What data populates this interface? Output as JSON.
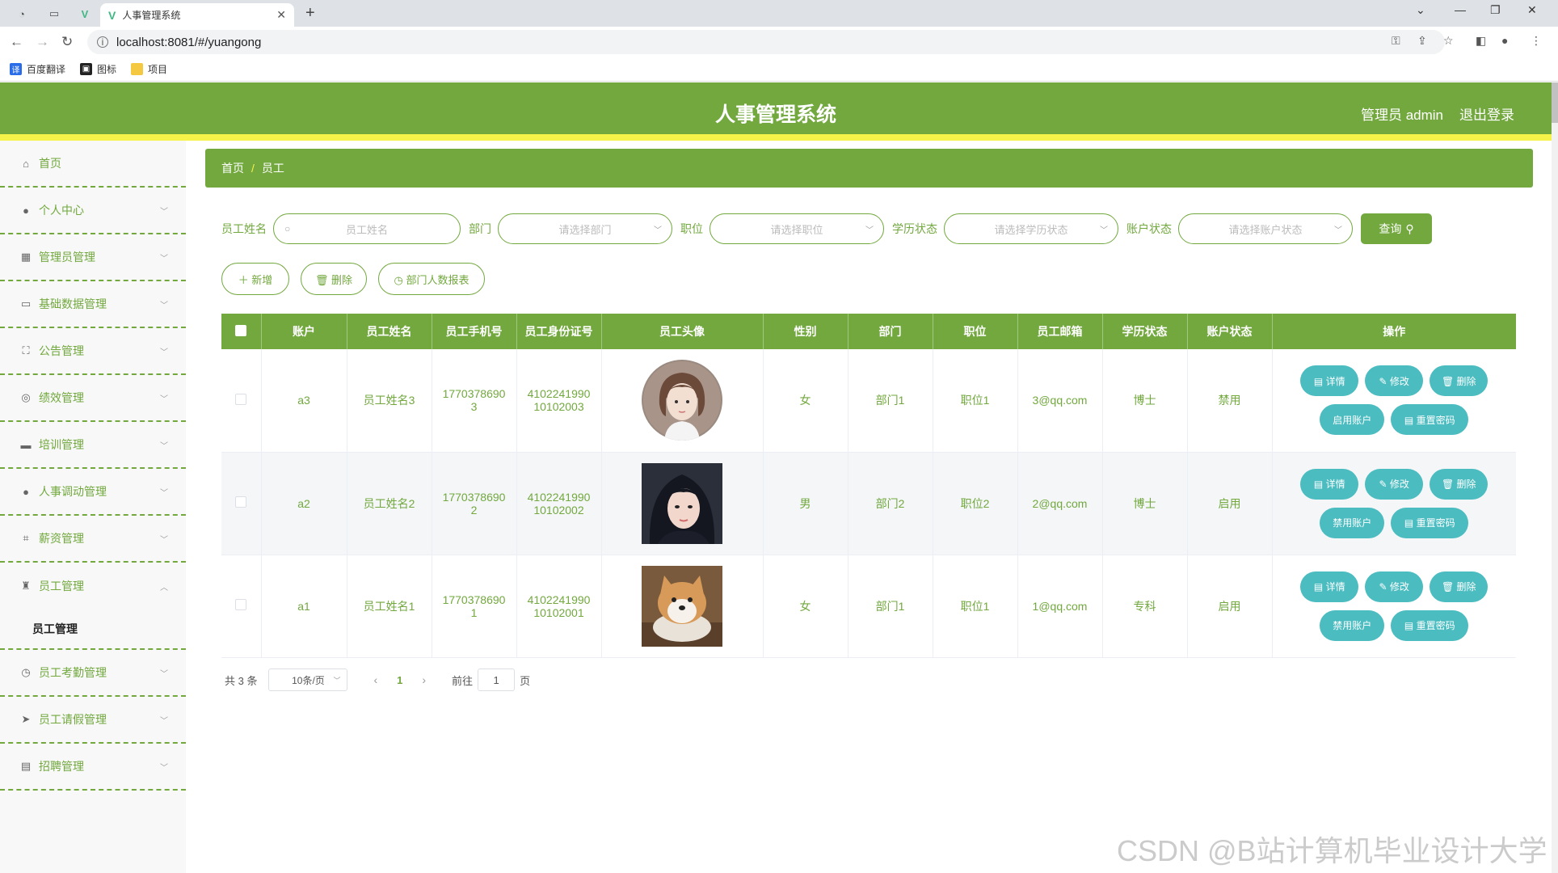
{
  "browser": {
    "tab_title": "人事管理系统",
    "url": "localhost:8081/#/yuangong",
    "bookmarks": [
      "百度翻译",
      "图标",
      "项目"
    ]
  },
  "header": {
    "title": "人事管理系统",
    "user": "管理员 admin",
    "logout": "退出登录",
    "accent": "#72a83e",
    "stripe": "#f5f24a"
  },
  "sidebar": {
    "items": [
      {
        "label": "首页",
        "icon": "home-icon"
      },
      {
        "label": "个人中心",
        "icon": "user-icon"
      },
      {
        "label": "管理员管理",
        "icon": "admin-icon"
      },
      {
        "label": "基础数据管理",
        "icon": "card-icon"
      },
      {
        "label": "公告管理",
        "icon": "frame-icon"
      },
      {
        "label": "绩效管理",
        "icon": "compass-icon"
      },
      {
        "label": "培训管理",
        "icon": "monitor-icon"
      },
      {
        "label": "人事调动管理",
        "icon": "user-icon"
      },
      {
        "label": "薪资管理",
        "icon": "crop-icon"
      },
      {
        "label": "员工管理",
        "icon": "group-icon"
      }
    ],
    "sub_item": "员工管理",
    "items_after": [
      {
        "label": "员工考勤管理",
        "icon": "clock-icon"
      },
      {
        "label": "员工请假管理",
        "icon": "send-icon"
      },
      {
        "label": "招聘管理",
        "icon": "board-icon"
      }
    ]
  },
  "breadcrumb": {
    "home": "首页",
    "sep": "/",
    "current": "员工"
  },
  "search": {
    "name_label": "员工姓名",
    "name_placeholder": "员工姓名",
    "dept_label": "部门",
    "dept_placeholder": "请选择部门",
    "pos_label": "职位",
    "pos_placeholder": "请选择职位",
    "edu_label": "学历状态",
    "edu_placeholder": "请选择学历状态",
    "acct_label": "账户状态",
    "acct_placeholder": "请选择账户状态",
    "query": "查询"
  },
  "actions": {
    "add": "＋ 新增",
    "delete": "🗑 删除",
    "report": "◷ 部门人数报表"
  },
  "table": {
    "headers": [
      "账户",
      "员工姓名",
      "员工手机号",
      "员工身份证号",
      "员工头像",
      "性别",
      "部门",
      "职位",
      "员工邮箱",
      "学历状态",
      "账户状态",
      "操作"
    ],
    "rows": [
      {
        "account": "a3",
        "name": "员工姓名3",
        "phone": "17703786903",
        "phone_a": "1770378690",
        "phone_b": "3",
        "id_a": "4102241990",
        "id_b": "10102003",
        "gender": "女",
        "dept": "部门1",
        "position": "职位1",
        "email": "3@qq.com",
        "edu": "博士",
        "status": "禁用",
        "toggle": "启用账户"
      },
      {
        "account": "a2",
        "name": "员工姓名2",
        "phone": "17703786902",
        "phone_a": "1770378690",
        "phone_b": "2",
        "id_a": "4102241990",
        "id_b": "10102002",
        "gender": "男",
        "dept": "部门2",
        "position": "职位2",
        "email": "2@qq.com",
        "edu": "博士",
        "status": "启用",
        "toggle": "禁用账户"
      },
      {
        "account": "a1",
        "name": "员工姓名1",
        "phone": "17703786901",
        "phone_a": "1770378690",
        "phone_b": "1",
        "id_a": "4102241990",
        "id_b": "10102001",
        "gender": "女",
        "dept": "部门1",
        "position": "职位1",
        "email": "1@qq.com",
        "edu": "专科",
        "status": "启用",
        "toggle": "禁用账户"
      }
    ],
    "ops": {
      "detail": "▤ 详情",
      "edit": "✎ 修改",
      "delete": "🗑 删除",
      "reset": "▤ 重置密码"
    }
  },
  "pager": {
    "total": "共 3 条",
    "size": "10条/页",
    "current": "1",
    "goto": "前往",
    "goto_value": "1",
    "page": "页"
  },
  "watermark": "CSDN @B站计算机毕业设计大学"
}
